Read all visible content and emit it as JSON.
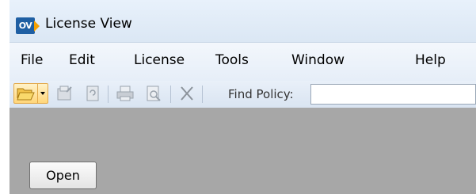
{
  "window": {
    "title": "License View",
    "logo_text": "OV"
  },
  "menubar": {
    "items": [
      {
        "label": "File"
      },
      {
        "label": "Edit"
      },
      {
        "label": "License"
      },
      {
        "label": "Tools"
      },
      {
        "label": "Window"
      },
      {
        "label": "Help"
      }
    ]
  },
  "toolbar": {
    "buttons": [
      "open-folder",
      "properties",
      "refresh",
      "print",
      "print-preview",
      "delete"
    ],
    "find_label": "Find Policy:",
    "find_value": ""
  },
  "content": {
    "open_button_label": "Open"
  },
  "colors": {
    "workspace": "#a7a7a7",
    "titlebar": "#dbe7f4",
    "logo": "#1f5fa3",
    "logo_accent": "#f6a000"
  }
}
